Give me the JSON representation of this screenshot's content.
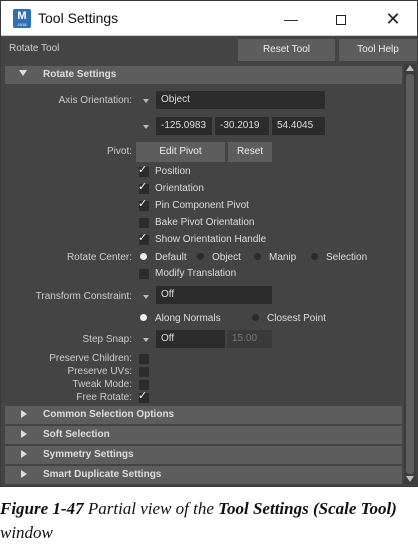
{
  "window": {
    "title": "Tool Settings",
    "icon_letter": "M",
    "icon_sub": "2018"
  },
  "controls": {
    "minimize": "—",
    "close": "✕"
  },
  "header": {
    "tool_name": "Rotate Tool",
    "reset_tool": "Reset Tool",
    "tool_help": "Tool Help"
  },
  "rotate_settings": {
    "title": "Rotate Settings",
    "axis_orientation": {
      "label": "Axis Orientation:",
      "value": "Object"
    },
    "axis_values": [
      "-125.0983",
      "-30.2019",
      "54.4045"
    ],
    "pivot": {
      "label": "Pivot:",
      "edit_pivot": "Edit Pivot",
      "reset": "Reset"
    },
    "checkboxes": [
      {
        "label": "Position",
        "checked": true
      },
      {
        "label": "Orientation",
        "checked": true
      },
      {
        "label": "Pin Component Pivot",
        "checked": true
      },
      {
        "label": "Bake Pivot Orientation",
        "checked": false
      },
      {
        "label": "Show Orientation Handle",
        "checked": true
      }
    ],
    "rotate_center": {
      "label": "Rotate Center:",
      "options": [
        "Default",
        "Object",
        "Manip",
        "Selection"
      ],
      "selected": "Default"
    },
    "modify_translation": {
      "label": "Modify Translation",
      "checked": false
    },
    "transform_constraint": {
      "label": "Transform Constraint:",
      "value": "Off"
    },
    "normals": {
      "along_normals": "Along Normals",
      "closest_point": "Closest Point",
      "selected": "Along Normals"
    },
    "step_snap": {
      "label": "Step Snap:",
      "value": "Off",
      "amount": "15.00"
    },
    "preserve": [
      {
        "label": "Preserve Children:",
        "checked": false
      },
      {
        "label": "Preserve UVs:",
        "checked": false
      },
      {
        "label": "Tweak Mode:",
        "checked": false
      },
      {
        "label": "Free Rotate:",
        "checked": true
      }
    ]
  },
  "collapsed_sections": [
    "Common Selection Options",
    "Soft Selection",
    "Symmetry Settings",
    "Smart Duplicate Settings"
  ],
  "caption": {
    "figure": "Figure 1-47",
    "text_a": "Partial view of the",
    "text_b": "Tool Settings (Scale Tool)",
    "text_c": "window"
  }
}
